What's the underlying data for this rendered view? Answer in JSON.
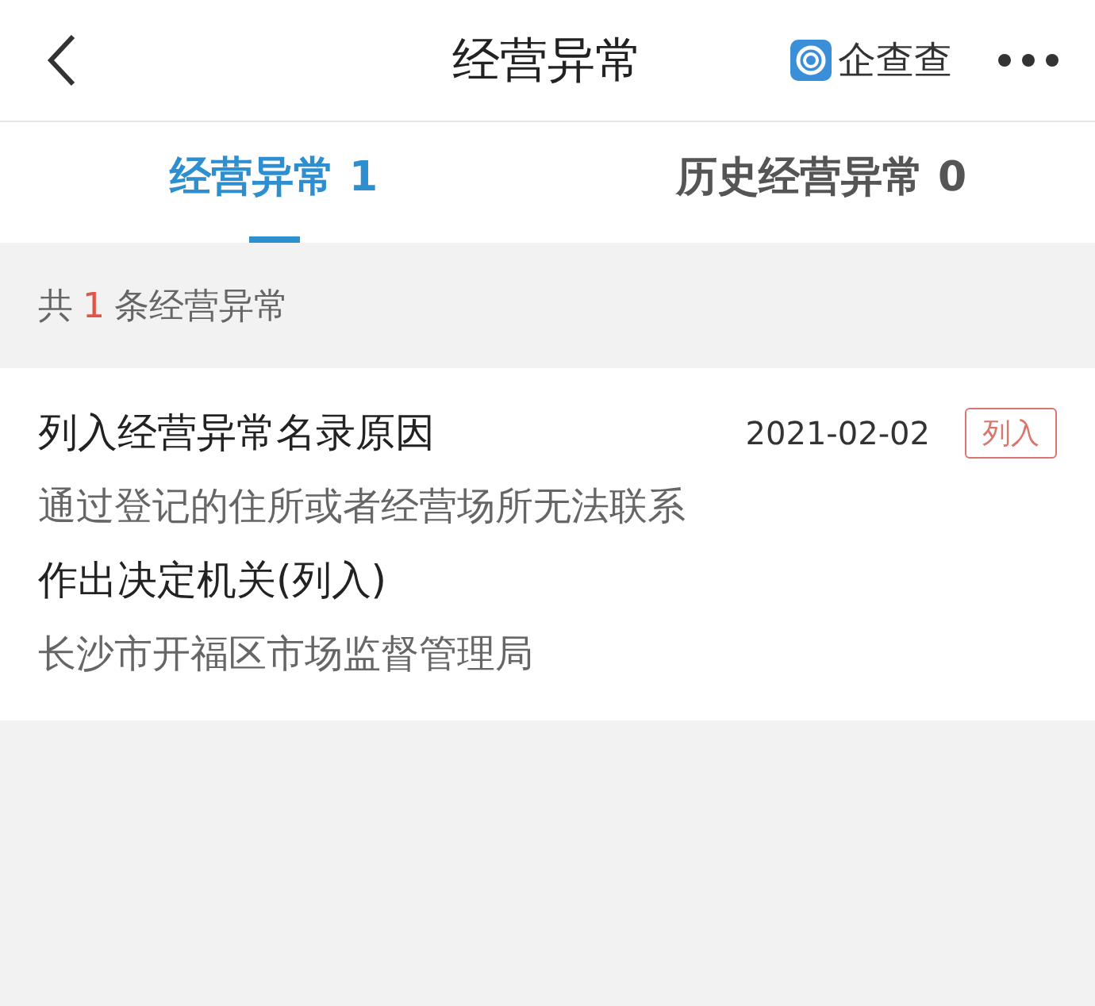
{
  "header": {
    "title": "经营异常",
    "brand": "企查查"
  },
  "tabs": [
    {
      "label": "经营异常 1",
      "selected": true
    },
    {
      "label": "历史经营异常 0",
      "selected": false
    }
  ],
  "summary": {
    "prefix": "共",
    "count": "1",
    "suffix": "条经营异常"
  },
  "records": [
    {
      "reason_label": "列入经营异常名录原因",
      "date": "2021-02-02",
      "tag": "列入",
      "reason": "通过登记的住所或者经营场所无法联系",
      "authority_label": "作出决定机关(列入)",
      "authority": "长沙市开福区市场监督管理局"
    }
  ]
}
